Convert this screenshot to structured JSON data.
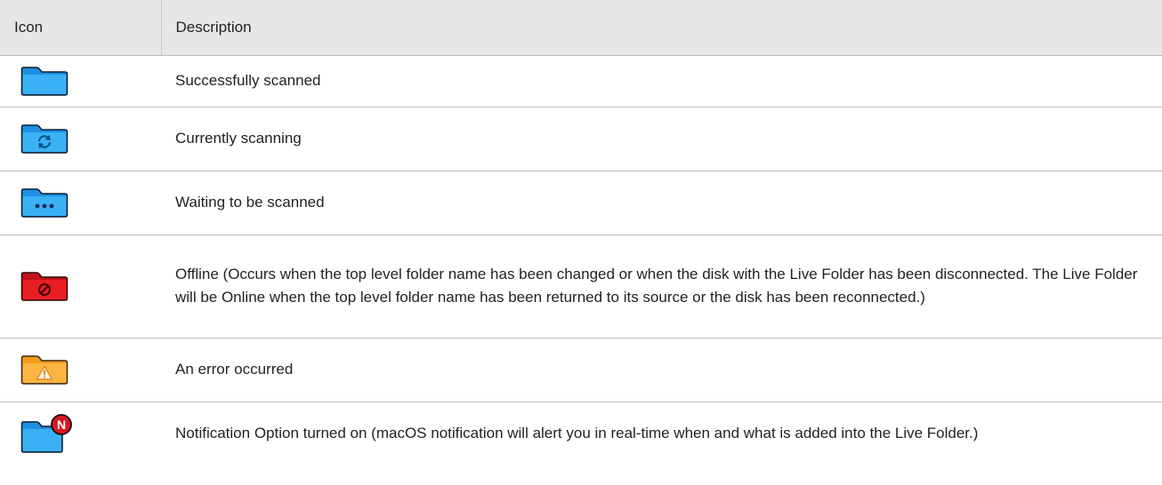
{
  "header": {
    "icon_col": "Icon",
    "desc_col": "Description"
  },
  "rows": [
    {
      "icon": "folder-scanned-icon",
      "description": "Successfully scanned"
    },
    {
      "icon": "folder-scanning-icon",
      "description": "Currently scanning"
    },
    {
      "icon": "folder-waiting-icon",
      "description": "Waiting to be scanned"
    },
    {
      "icon": "folder-offline-icon",
      "description": "Offline (Occurs when the top level folder name has been changed or when the disk with the Live Folder has been disconnected. The Live Folder will be Online when the top level folder name has been returned to its source or the disk has been reconnected.)"
    },
    {
      "icon": "folder-error-icon",
      "description": "An error occurred"
    },
    {
      "icon": "folder-notification-icon",
      "badge_letter": "N",
      "description": "Notification Option turned on (macOS notification will alert you in real-time when and what is added into the Live Folder.)"
    }
  ],
  "colors": {
    "header_bg": "#e6e7e8",
    "folder_blue": "#2aa3ef",
    "folder_red": "#e0171b",
    "folder_orange": "#f9ad35",
    "badge_red": "#d7171f"
  }
}
